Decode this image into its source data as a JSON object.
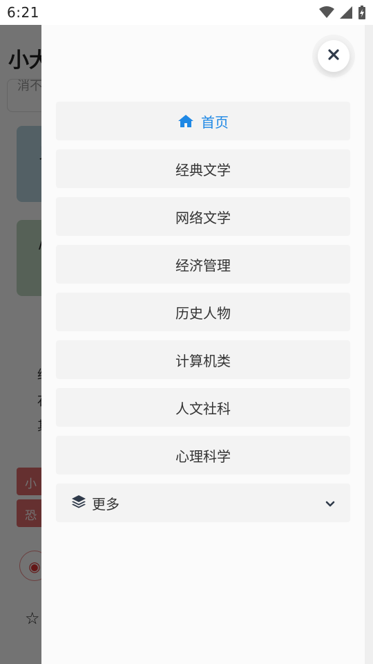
{
  "status_bar": {
    "time": "6:21",
    "icons": [
      "wifi-icon",
      "signal-icon",
      "battery-charging-icon"
    ]
  },
  "background_page": {
    "title": "小大",
    "search_placeholder": "消不",
    "card1_text": "贝",
    "card2_text": "/",
    "list_texts": [
      "",
      "终",
      "石",
      "其"
    ],
    "tags": [
      "小",
      "恐"
    ],
    "weibo_icon": "weibo-icon",
    "star_icon": "star-icon"
  },
  "drawer": {
    "close_icon": "close-icon",
    "items": [
      {
        "label": "首页",
        "icon": "home-icon",
        "active": true
      },
      {
        "label": "经典文学"
      },
      {
        "label": "网络文学"
      },
      {
        "label": "经济管理"
      },
      {
        "label": "历史人物"
      },
      {
        "label": "计算机类"
      },
      {
        "label": "人文社科"
      },
      {
        "label": "心理科学"
      }
    ],
    "more": {
      "label": "更多",
      "icon": "layers-icon",
      "chevron": "chevron-down-icon"
    },
    "colors": {
      "active": "#1e88e5",
      "item_bg": "#f3f3f3",
      "drawer_bg": "#fbfbfb"
    }
  }
}
